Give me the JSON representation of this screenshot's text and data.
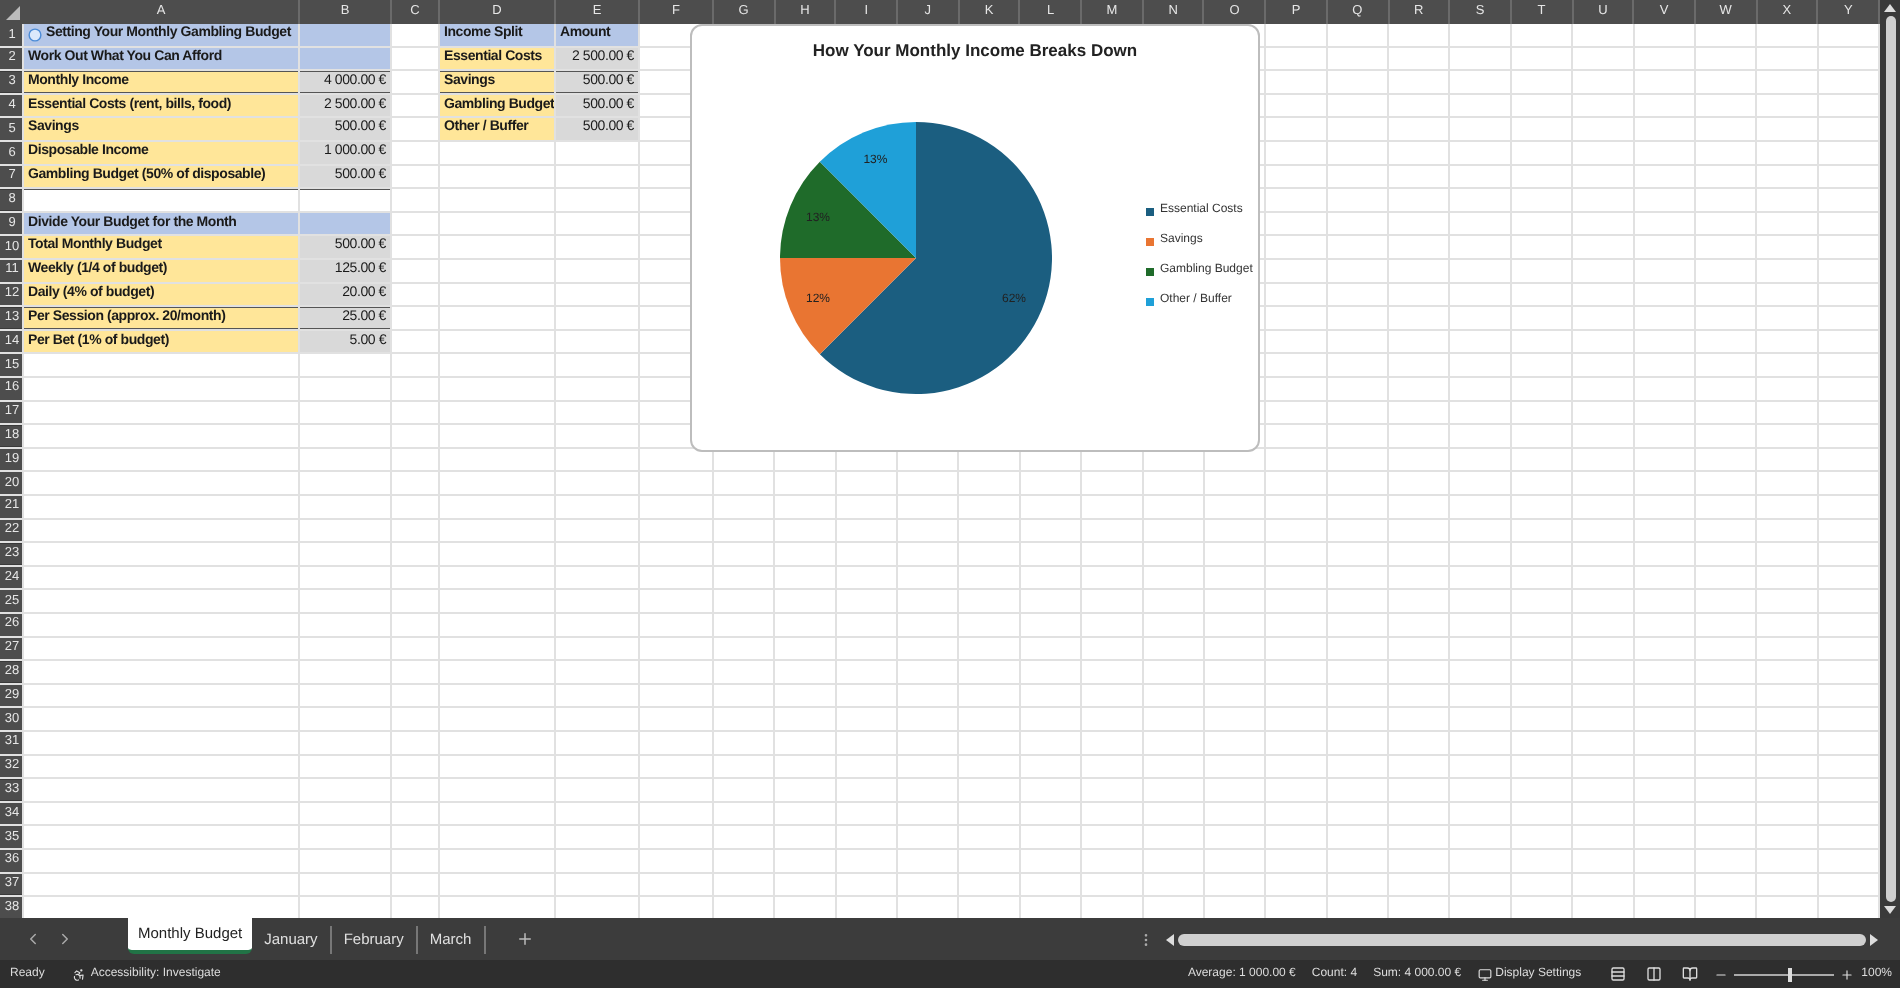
{
  "columns": [
    "A",
    "B",
    "C",
    "D",
    "E",
    "F",
    "G",
    "H",
    "I",
    "J",
    "K",
    "L",
    "M",
    "N",
    "O",
    "P",
    "Q",
    "R",
    "S",
    "T",
    "U",
    "V",
    "W",
    "X",
    "Y"
  ],
  "rows": [
    {
      "number": "1",
      "cells": [
        {
          "kind": "title",
          "text": "Setting Your Monthly Gambling Budget"
        },
        {
          "kind": "empty"
        },
        {
          "kind": "header",
          "text": "Income Split"
        },
        {
          "kind": "header",
          "text": "Amount"
        }
      ]
    },
    {
      "number": "2",
      "cells": [
        {
          "kind": "header",
          "text": "Work Out What You Can Afford"
        },
        {
          "kind": "header"
        },
        {
          "kind": "empty"
        },
        {
          "kind": "label",
          "text": "Essential Costs"
        },
        {
          "kind": "value",
          "text": "2 500.00 €"
        }
      ]
    },
    {
      "number": "3",
      "cells": [
        {
          "kind": "label",
          "text": "Monthly Income"
        },
        {
          "kind": "value",
          "text": "4 000.00 €"
        },
        {
          "kind": "empty"
        },
        {
          "kind": "label",
          "text": "Savings"
        },
        {
          "kind": "value",
          "text": "500.00 €"
        }
      ]
    },
    {
      "number": "4",
      "cells": [
        {
          "kind": "label",
          "text": "Essential Costs (rent, bills, food)"
        },
        {
          "kind": "value",
          "text": "2 500.00 €"
        },
        {
          "kind": "empty"
        },
        {
          "kind": "label",
          "text": "Gambling Budget"
        },
        {
          "kind": "value",
          "text": "500.00 €"
        }
      ]
    },
    {
      "number": "5",
      "cells": [
        {
          "kind": "label",
          "text": "Savings"
        },
        {
          "kind": "value",
          "text": "500.00 €"
        },
        {
          "kind": "empty"
        },
        {
          "kind": "label",
          "text": "Other / Buffer"
        },
        {
          "kind": "value",
          "text": "500.00 €"
        }
      ]
    },
    {
      "number": "6",
      "cells": [
        {
          "kind": "label",
          "text": "Disposable Income"
        },
        {
          "kind": "value",
          "text": "1 000.00 €"
        }
      ]
    },
    {
      "number": "7",
      "cells": [
        {
          "kind": "label",
          "text": "Gambling Budget (50% of disposable)"
        },
        {
          "kind": "value",
          "text": "500.00 €"
        }
      ]
    },
    {
      "number": "8",
      "cells": []
    },
    {
      "number": "9",
      "cells": [
        {
          "kind": "header",
          "text": "Divide Your Budget for the Month"
        },
        {
          "kind": "header"
        }
      ]
    },
    {
      "number": "10",
      "cells": [
        {
          "kind": "label",
          "text": "Total Monthly Budget"
        },
        {
          "kind": "value",
          "text": "500.00 €"
        }
      ]
    },
    {
      "number": "11",
      "cells": [
        {
          "kind": "label",
          "text": "Weekly (1/4 of budget)"
        },
        {
          "kind": "value",
          "text": "125.00 €"
        }
      ]
    },
    {
      "number": "12",
      "cells": [
        {
          "kind": "label",
          "text": "Daily (4% of budget)"
        },
        {
          "kind": "value",
          "text": "20.00 €"
        }
      ]
    },
    {
      "number": "13",
      "cells": [
        {
          "kind": "label",
          "text": "Per Session (approx. 20/month)"
        },
        {
          "kind": "value",
          "text": "25.00 €"
        }
      ]
    },
    {
      "number": "14",
      "cells": [
        {
          "kind": "label",
          "text": "Per Bet (1% of budget)"
        },
        {
          "kind": "value",
          "text": "5.00 €"
        }
      ]
    },
    {
      "number": "15"
    },
    {
      "number": "16"
    },
    {
      "number": "17"
    },
    {
      "number": "18"
    },
    {
      "number": "19"
    },
    {
      "number": "20"
    },
    {
      "number": "21"
    },
    {
      "number": "22"
    },
    {
      "number": "23"
    },
    {
      "number": "24"
    },
    {
      "number": "25"
    },
    {
      "number": "26"
    },
    {
      "number": "27"
    },
    {
      "number": "28"
    },
    {
      "number": "29"
    },
    {
      "number": "30"
    },
    {
      "number": "31"
    },
    {
      "number": "32"
    },
    {
      "number": "33"
    },
    {
      "number": "34"
    },
    {
      "number": "35"
    },
    {
      "number": "36"
    },
    {
      "number": "37"
    },
    {
      "number": "38"
    }
  ],
  "chart": {
    "chart_data": {
      "type": "pie",
      "title": "How Your Monthly Income Breaks Down",
      "categories": [
        "Essential Costs",
        "Savings",
        "Gambling Budget",
        "Other / Buffer"
      ],
      "series": [
        {
          "colors": [
            "#1b5e80",
            "#e97532",
            "#1f6b2a",
            "#1fa0d8"
          ],
          "values": [
            62.5,
            12.5,
            12.5,
            12.5
          ]
        }
      ],
      "legend": true,
      "value_labels": [
        "62%",
        "12%",
        "13%",
        "13%"
      ]
    }
  },
  "sheet_tabs": [
    {
      "label": "Monthly Budget",
      "selected": true
    },
    {
      "label": "January",
      "selected": false
    },
    {
      "label": "February",
      "selected": false
    },
    {
      "label": "March",
      "selected": false
    }
  ],
  "status_bar": {
    "status": "Ready",
    "accessibility": "Accessibility: Investigate",
    "stats": [
      "Average: 1 000.00 €",
      "Count: 4",
      "Sum: 4 000.00 €"
    ],
    "display_settings": "Display Settings",
    "zoom": {
      "level": 0.55,
      "reading": "100%"
    }
  }
}
